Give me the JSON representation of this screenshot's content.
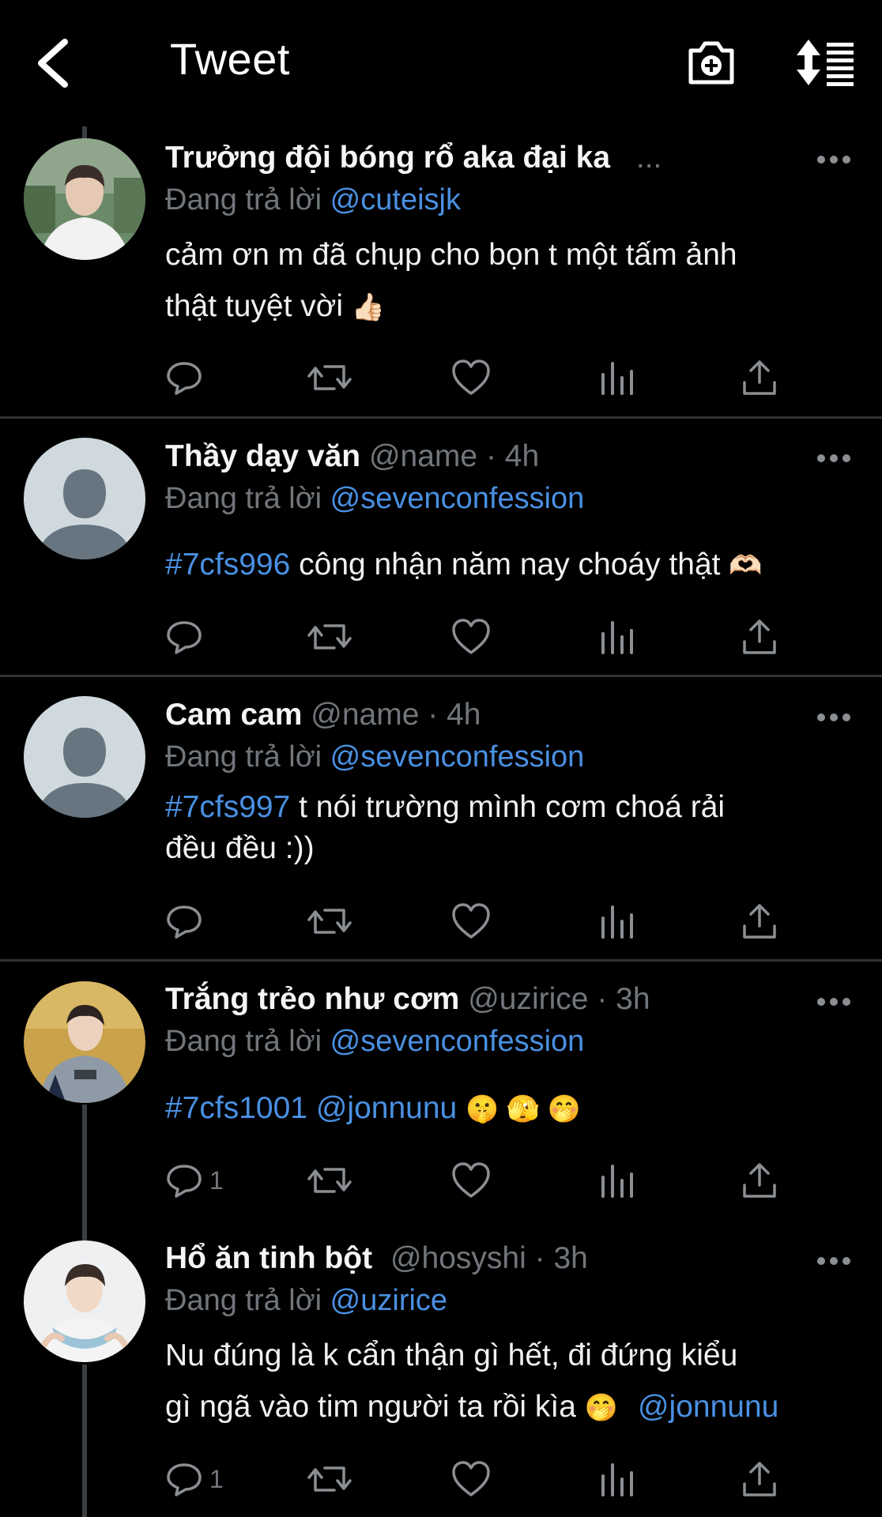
{
  "header": {
    "title": "Tweet",
    "back_icon": "chevron-left-icon",
    "icons": [
      "camera-add-icon",
      "sort-icon"
    ]
  },
  "tweets": [
    {
      "name": "Trưởng đội bóng rổ aka đại ka",
      "handle": "",
      "time": "",
      "truncation": "...",
      "reply_prefix": "Đang trả lời",
      "reply_to": "@cuteisjk",
      "text_line1": "cảm ơn m đã chụp cho bọn t một tấm ảnh",
      "text_line2": "thật tuyệt vời",
      "emoji": "👍🏻",
      "reply_count": ""
    },
    {
      "name": "Thầy dạy văn",
      "handle": "@name",
      "time": "· 4h",
      "reply_prefix": "Đang trả lời",
      "reply_to": "@sevenconfession",
      "hashtag": "#7cfs996",
      "text": " công nhận năm nay choáy thật",
      "emoji": "🫶🏻",
      "reply_count": ""
    },
    {
      "name": "Cam cam",
      "handle": "@name",
      "time": "· 4h",
      "reply_prefix": "Đang trả lời",
      "reply_to": "@sevenconfession",
      "hashtag": "#7cfs997",
      "text_line1": " t nói trường mình cơm choá rải",
      "text_line2": "đều đều :))",
      "reply_count": ""
    },
    {
      "name": "Trắng trẻo như cơm",
      "handle": "@uzirice",
      "time": "· 3h",
      "reply_prefix": "Đang trả lời",
      "reply_to": "@sevenconfession",
      "hashtag": "#7cfs1001",
      "mention": " @jonnunu",
      "emoji": "🤫 🫣 🤭",
      "reply_count": "1"
    },
    {
      "name": "Hổ ăn tinh bột",
      "handle": "@hosyshi",
      "time": "· 3h",
      "reply_prefix": "Đang trả lời",
      "reply_to": "@uzirice",
      "text_line1": "Nu đúng là k cẩn thận gì hết, đi đứng kiểu",
      "text_line2": "gì ngã vào tim người ta rồi kìa",
      "emoji": "🤭",
      "mention": "@jonnunu",
      "reply_count": "1"
    }
  ],
  "action_icons": [
    "reply-icon",
    "retweet-icon",
    "like-icon",
    "analytics-icon",
    "share-icon"
  ],
  "colors": {
    "background": "#000000",
    "link": "#4a90e2",
    "muted": "#71767b",
    "separator": "#2f3336"
  }
}
